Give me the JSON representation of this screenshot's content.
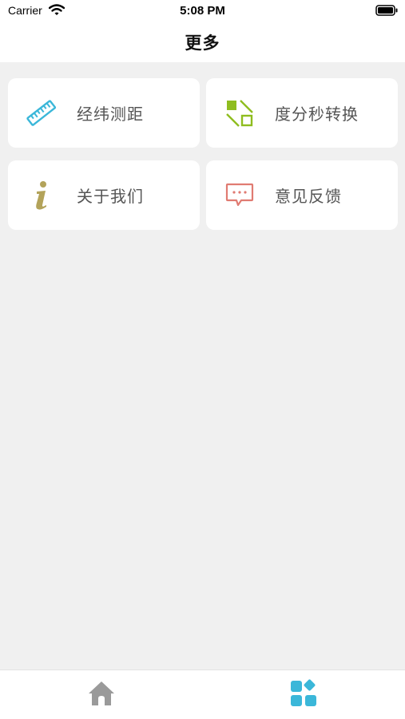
{
  "status_bar": {
    "carrier": "Carrier",
    "time": "5:08 PM"
  },
  "nav": {
    "title": "更多"
  },
  "menu": [
    {
      "label": "经纬测距",
      "icon": "ruler-icon",
      "color": "#3bb7d9"
    },
    {
      "label": "度分秒转换",
      "icon": "convert-icon",
      "color": "#8fbd1f"
    },
    {
      "label": "关于我们",
      "icon": "info-icon",
      "color": "#b3a35a"
    },
    {
      "label": "意见反馈",
      "icon": "feedback-icon",
      "color": "#e07b72"
    }
  ],
  "tabs": [
    {
      "icon": "home-icon",
      "color": "#9a9a9a",
      "selected": false
    },
    {
      "icon": "apps-icon",
      "color": "#3bb7d9",
      "selected": true
    }
  ]
}
